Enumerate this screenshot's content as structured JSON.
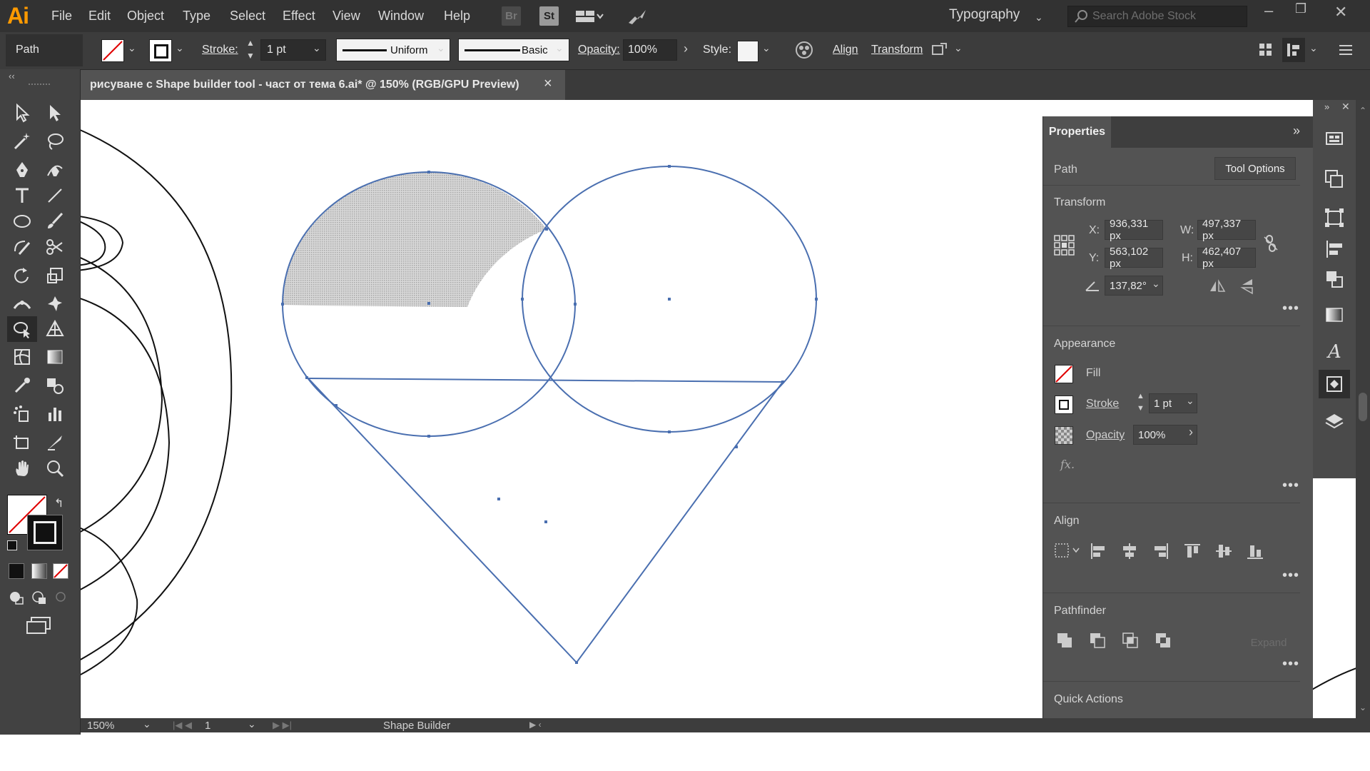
{
  "app": {
    "logo": "Ai",
    "menu": [
      "File",
      "Edit",
      "Object",
      "Type",
      "Select",
      "Effect",
      "View",
      "Window",
      "Help"
    ],
    "bridge_label": "Br",
    "stock_label": "St",
    "workspace": "Typography",
    "search_placeholder": "Search Adobe Stock"
  },
  "control_bar": {
    "selection_type": "Path",
    "stroke_label": "Stroke:",
    "stroke_weight": "1 pt",
    "profile": "Uniform",
    "brush": "Basic",
    "opacity_label": "Opacity:",
    "opacity": "100%",
    "style_label": "Style:",
    "align_label": "Align",
    "transform_label": "Transform"
  },
  "document": {
    "tab_title": "рисуване с Shape builder tool - част от тема 6.ai* @ 150% (RGB/GPU Preview)",
    "close": "×"
  },
  "status_bar": {
    "zoom": "150%",
    "artboard": "1",
    "tool": "Shape Builder"
  },
  "properties": {
    "tab": "Properties",
    "object_type": "Path",
    "tool_options": "Tool Options",
    "transform": {
      "title": "Transform",
      "x_label": "X:",
      "x": "936,331 px",
      "y_label": "Y:",
      "y": "563,102 px",
      "w_label": "W:",
      "w": "497,337 px",
      "h_label": "H:",
      "h": "462,407 px",
      "angle": "137,82°"
    },
    "appearance": {
      "title": "Appearance",
      "fill_label": "Fill",
      "stroke_label": "Stroke",
      "stroke_weight": "1 pt",
      "opacity_label": "Opacity",
      "opacity": "100%",
      "fx": "fx."
    },
    "align": {
      "title": "Align"
    },
    "pathfinder": {
      "title": "Pathfinder",
      "expand": "Expand"
    },
    "quick_actions": {
      "title": "Quick Actions"
    }
  },
  "colors": {
    "menubar": "#323232",
    "panel": "#535353",
    "selection": "#4a6fb0",
    "shape_fill": "#c9c9c9",
    "logo": "#ff9a00"
  }
}
